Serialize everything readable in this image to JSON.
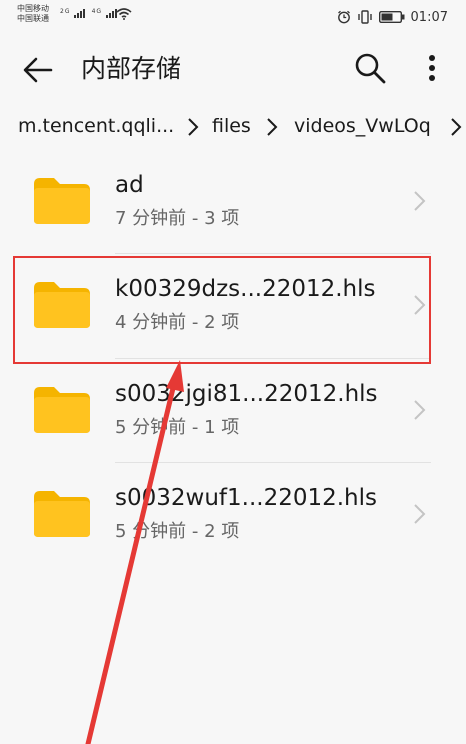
{
  "status_bar": {
    "carrier_1": "中国移动",
    "carrier_2": "中国联通",
    "net_1": "2G",
    "net_2": "4G",
    "time": "01:07"
  },
  "app_bar": {
    "title": "内部存储"
  },
  "breadcrumb": {
    "items": [
      "m.tencent.qqli...",
      "files",
      "videos_VwLOq"
    ]
  },
  "files": [
    {
      "name": "ad",
      "meta": "7 分钟前 - 3 项"
    },
    {
      "name": "k00329dzs...22012.hls",
      "meta": "4 分钟前 - 2 项"
    },
    {
      "name": "s0032jgi81...22012.hls",
      "meta": "5 分钟前 - 1 项"
    },
    {
      "name": "s0032wuf1...22012.hls",
      "meta": "5 分钟前 - 2 项"
    }
  ],
  "colors": {
    "folder": "#ffc31f",
    "folder_tab": "#f5b400",
    "highlight": "#e53935",
    "background": "#f7f7f7"
  },
  "icons": {
    "back": "arrow-left-icon",
    "search": "search-icon",
    "more": "more-vertical-icon",
    "folder": "folder-icon",
    "chevron": "chevron-right-icon"
  }
}
